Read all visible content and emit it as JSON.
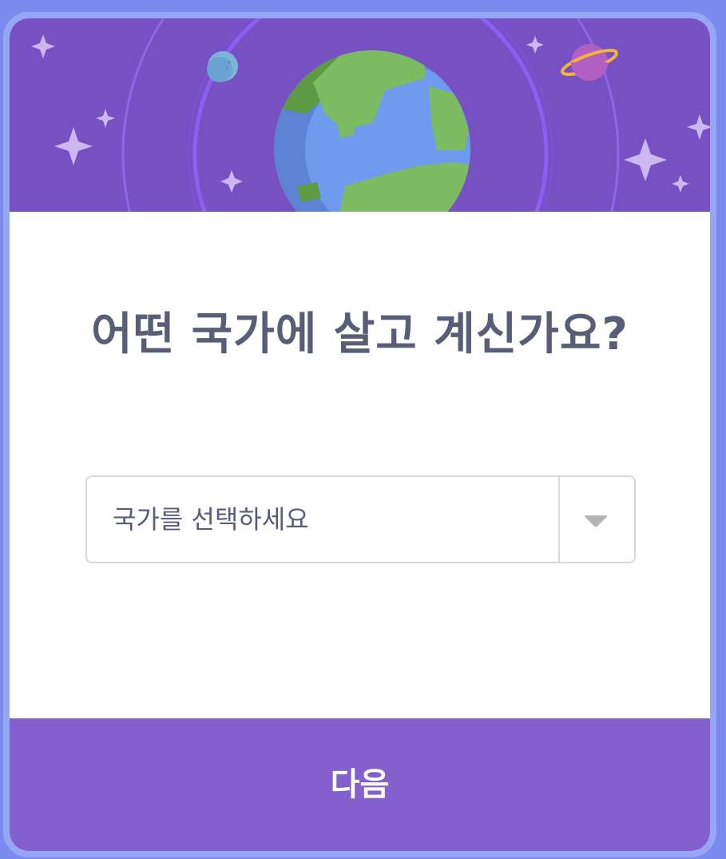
{
  "dialog": {
    "question": "어떤 국가에 살고 계신가요?",
    "country_select": {
      "placeholder": "국가를 선택하세요",
      "arrow_icon": "caret-down-icon"
    },
    "next_button": {
      "label": "다음"
    }
  },
  "header_illustration": {
    "icons": [
      "globe-icon",
      "moon-icon",
      "planet-icon",
      "sparkle-icon"
    ]
  },
  "colors": {
    "page_background": "#7b8aec",
    "border": "#95a6f5",
    "header_background": "#7751c4",
    "footer_button": "#8460cf",
    "question_text": "#575e75",
    "select_border": "#d9d9d9"
  }
}
